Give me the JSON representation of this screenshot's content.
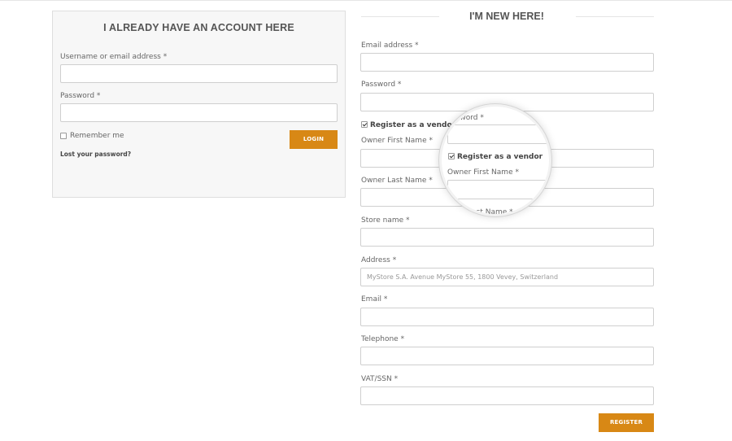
{
  "login": {
    "title": "I ALREADY HAVE AN ACCOUNT HERE",
    "username_label": "Username or email address *",
    "username_value": "",
    "password_label": "Password *",
    "password_value": "",
    "remember_label": "Remember me",
    "remember_checked": false,
    "login_button": "LOGIN",
    "lost_password": "Lost your password?"
  },
  "register": {
    "title": "I'M NEW HERE!",
    "email_label": "Email address *",
    "password_label": "Password *",
    "vendor_label": "Register as a vendor",
    "vendor_checked": true,
    "owner_first_label": "Owner First Name *",
    "owner_last_label": "Owner Last Name *",
    "store_name_label": "Store name *",
    "address_label": "Address *",
    "address_placeholder": "MyStore S.A. Avenue MyStore 55, 1800 Vevey, Switzerland",
    "email2_label": "Email *",
    "telephone_label": "Telephone *",
    "vat_label": "VAT/SSN *",
    "register_button": "REGISTER"
  },
  "magnifier": {
    "password_fragment": "ssword *",
    "vendor_label": "Register as a vendor",
    "owner_first_label": "Owner First Name *",
    "owner_last_fragment": "er Last Name *"
  },
  "colors": {
    "accent": "#d88815",
    "panel_bg": "#f7f7f7",
    "border": "#cfcfcf"
  }
}
